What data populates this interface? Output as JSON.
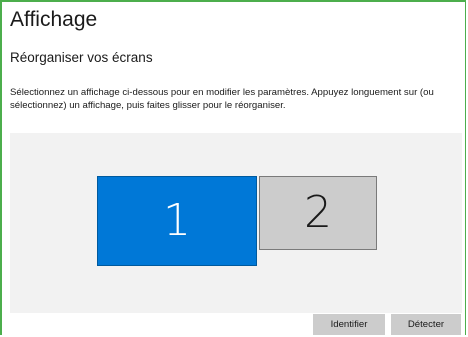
{
  "header": {
    "title": "Affichage"
  },
  "arrangement": {
    "heading": "Réorganiser vos écrans",
    "instructions": "Sélectionnez un affichage ci-dessous pour en modifier les paramètres. Appuyez longuement sur (ou sélectionnez) un affichage, puis faites glisser pour le réorganiser.",
    "displays": [
      {
        "label": "1",
        "selected": true,
        "color": "#0078d7"
      },
      {
        "label": "2",
        "selected": false,
        "color": "#cccccc"
      }
    ]
  },
  "actions": {
    "identify_label": "Identifier",
    "detect_label": "Détecter"
  },
  "colors": {
    "accent": "#0078d7",
    "frame_border": "#4cae4c",
    "area_background": "#f2f2f2",
    "button_background": "#cccccc"
  }
}
